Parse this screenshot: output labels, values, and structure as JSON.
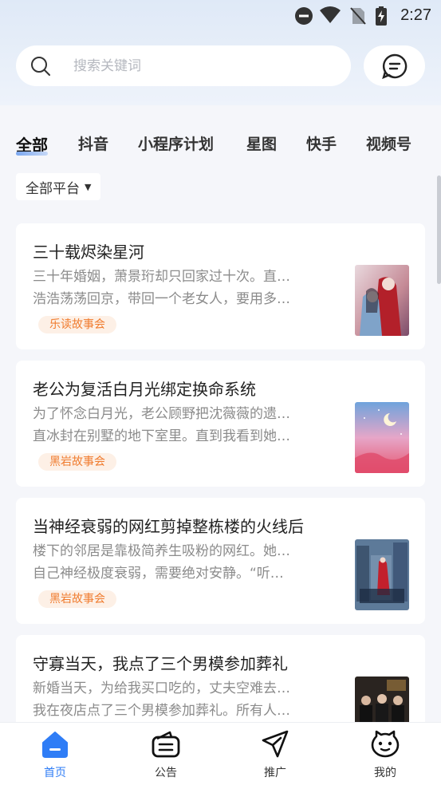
{
  "status": {
    "time": "2:27"
  },
  "search": {
    "placeholder": "搜索关键词"
  },
  "tabs": [
    "全部",
    "抖音",
    "小程序计划",
    "星图",
    "快手",
    "视频号"
  ],
  "platform_filter": {
    "label": "全部平台"
  },
  "cards": [
    {
      "title": "三十载烬染星河",
      "desc": [
        "三十年婚姻，萧景珩却只回家过十次。直…",
        "浩浩荡荡回京，带回一个老女人，要用多…"
      ],
      "tag": "乐读故事会"
    },
    {
      "title": "老公为复活白月光绑定换命系统",
      "desc": [
        "为了怀念白月光，老公顾野把沈薇薇的遗…",
        "直冰封在别墅的地下室里。直到我看到她…"
      ],
      "tag": "黑岩故事会"
    },
    {
      "title": "当神经衰弱的网红剪掉整栋楼的火线后",
      "desc": [
        "楼下的邻居是靠极简养生吸粉的网红。她…",
        "自己神经极度衰弱，需要绝对安静。“听…"
      ],
      "tag": "黑岩故事会"
    },
    {
      "title": "守寡当天，我点了三个男模参加葬礼",
      "desc": [
        "新婚当天，为给我买口吃的，丈夫空难去…",
        "我在夜店点了三个男模参加葬礼。所有人…"
      ],
      "tag": ""
    }
  ],
  "bottom_nav": [
    {
      "label": "首页",
      "icon": "home-icon",
      "active": true
    },
    {
      "label": "公告",
      "icon": "announcement-icon",
      "active": false
    },
    {
      "label": "推广",
      "icon": "promote-icon",
      "active": false
    },
    {
      "label": "我的",
      "icon": "profile-icon",
      "active": false
    }
  ],
  "colors": {
    "accent": "#2f7df6",
    "tag_text": "#f07b2e",
    "tag_bg": "#fdf0e6"
  }
}
